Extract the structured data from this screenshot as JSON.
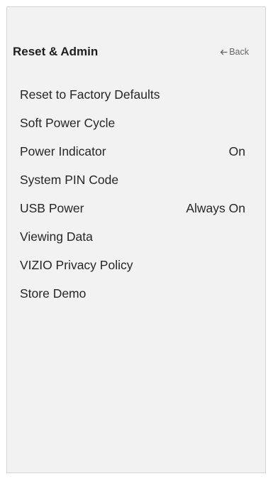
{
  "header": {
    "title": "Reset & Admin",
    "back_label": "Back"
  },
  "menu": {
    "items": [
      {
        "label": "Reset to Factory Defaults",
        "value": ""
      },
      {
        "label": "Soft Power Cycle",
        "value": ""
      },
      {
        "label": "Power Indicator",
        "value": "On"
      },
      {
        "label": "System PIN Code",
        "value": ""
      },
      {
        "label": "USB Power",
        "value": "Always On"
      },
      {
        "label": "Viewing Data",
        "value": ""
      },
      {
        "label": "VIZIO Privacy Policy",
        "value": ""
      },
      {
        "label": "Store Demo",
        "value": ""
      }
    ]
  },
  "icons": {
    "back": "arrow-left-icon"
  },
  "colors": {
    "background": "#f2f2f2",
    "text": "#262626",
    "muted": "#666666"
  }
}
